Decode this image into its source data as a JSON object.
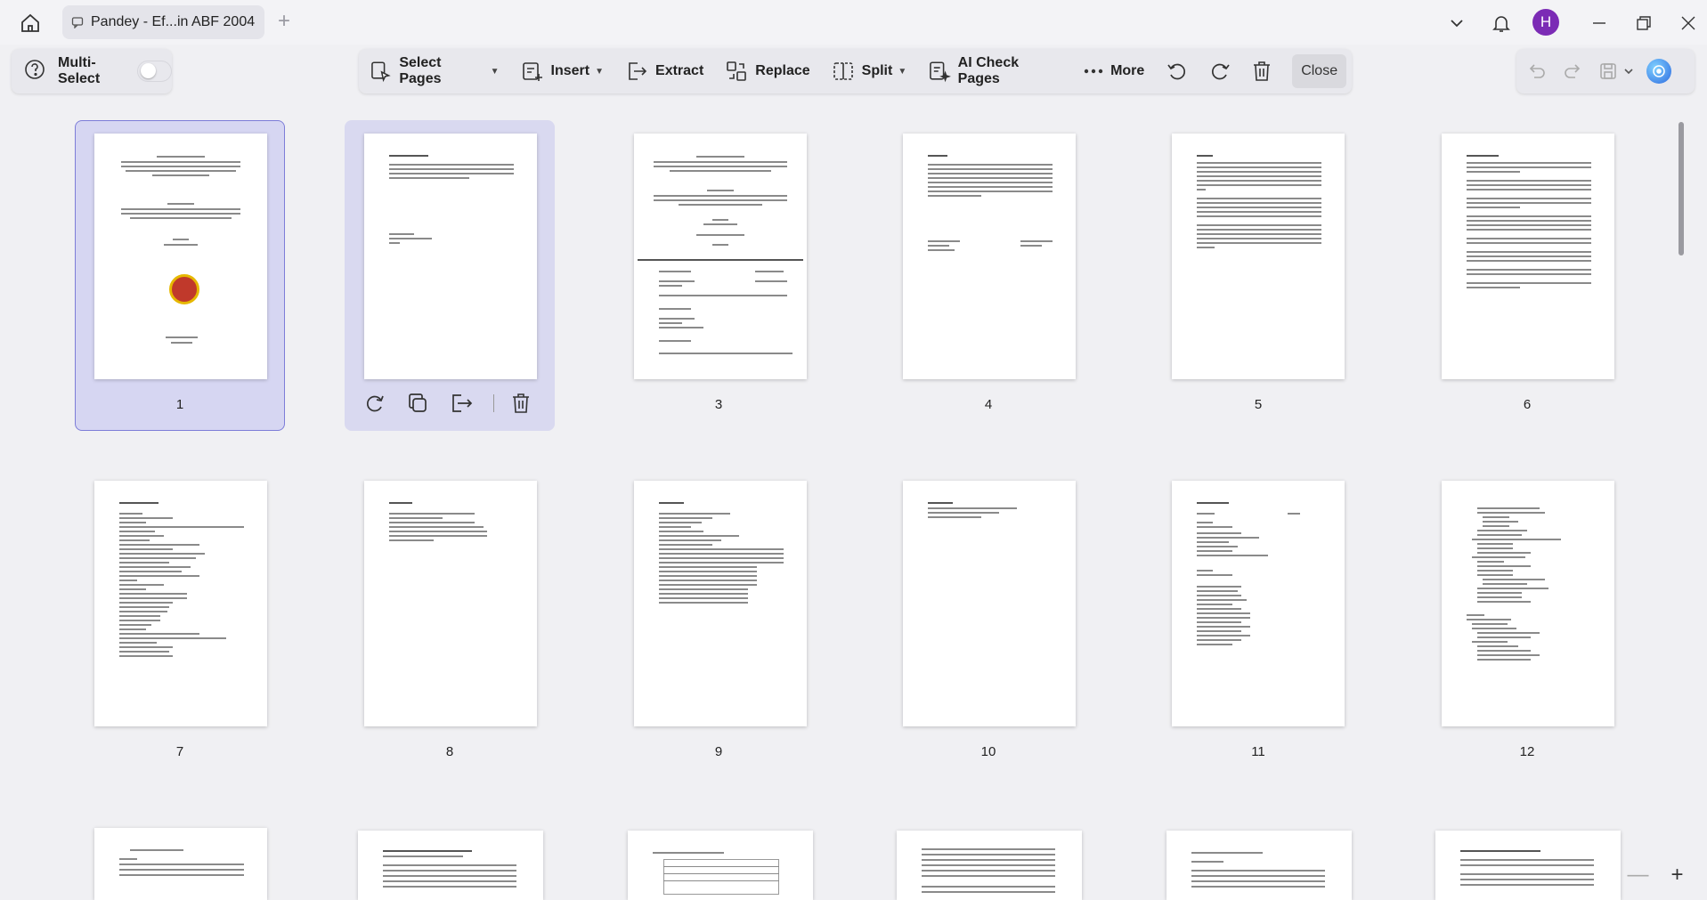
{
  "titlebar": {
    "tab_title": "Pandey - Ef...in ABF 2004",
    "new_tab_symbol": "+",
    "avatar_initial": "H"
  },
  "toolbar": {
    "multi_select_label": "Multi-Select",
    "select_pages_label": "Select Pages",
    "insert_label": "Insert",
    "extract_label": "Extract",
    "replace_label": "Replace",
    "split_label": "Split",
    "ai_check_label": "AI Check Pages",
    "more_label": "More",
    "close_label": "Close"
  },
  "pages": [
    {
      "num": "1",
      "selected": true
    },
    {
      "num": "2",
      "selected": true
    },
    {
      "num": "3"
    },
    {
      "num": "4"
    },
    {
      "num": "5"
    },
    {
      "num": "6"
    },
    {
      "num": "7"
    },
    {
      "num": "8"
    },
    {
      "num": "9"
    },
    {
      "num": "10"
    },
    {
      "num": "11"
    },
    {
      "num": "12"
    }
  ],
  "thumb_text": {
    "p1_title": "ARSENIC REMOVAL FILTER",
    "p2_title": "Declaration by student",
    "p4_title": "Certificate",
    "p5_title": "Abstract",
    "p6_title": "Acknowledgement",
    "p7_title": "List of abbreviations",
    "p8_title": "List of Tables",
    "p9_title": "List of Figures",
    "p10_title": "APPENDICES",
    "p11_title": "Table Of Contents",
    "p14_title": "CHAPTER 2 HISTORICAL BACKGROUND",
    "p15_title": "Table 1: Proposed Drinking Water Quality in Nepal"
  },
  "zoom": {
    "minus": "—",
    "plus": "+"
  },
  "colors": {
    "selection": "#d6d6f2",
    "selection_border": "#7d7dd8",
    "avatar": "#7b2bb5"
  }
}
